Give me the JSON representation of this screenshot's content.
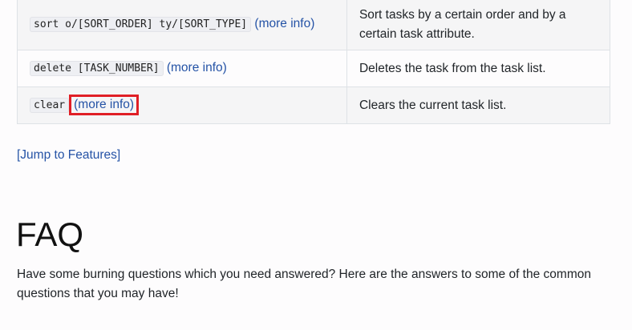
{
  "commands": [
    {
      "command": "sort o/[SORT_ORDER] ty/[SORT_TYPE]",
      "link_text": "(more info)",
      "description": "Sort tasks by a certain order and by a certain task attribute."
    },
    {
      "command": "delete [TASK_NUMBER]",
      "link_text": "(more info)",
      "description": "Deletes the task from the task list."
    },
    {
      "command": "clear",
      "link_text": "(more info)",
      "description": "Clears the current task list."
    }
  ],
  "jump_link": "[Jump to Features]",
  "faq": {
    "heading": "FAQ",
    "intro": "Have some burning questions which you need answered? Here are the answers to some of the common questions that you may have!"
  },
  "colors": {
    "link": "#2553a6",
    "highlight": "#e01f26",
    "table_border": "#dee2e6"
  }
}
